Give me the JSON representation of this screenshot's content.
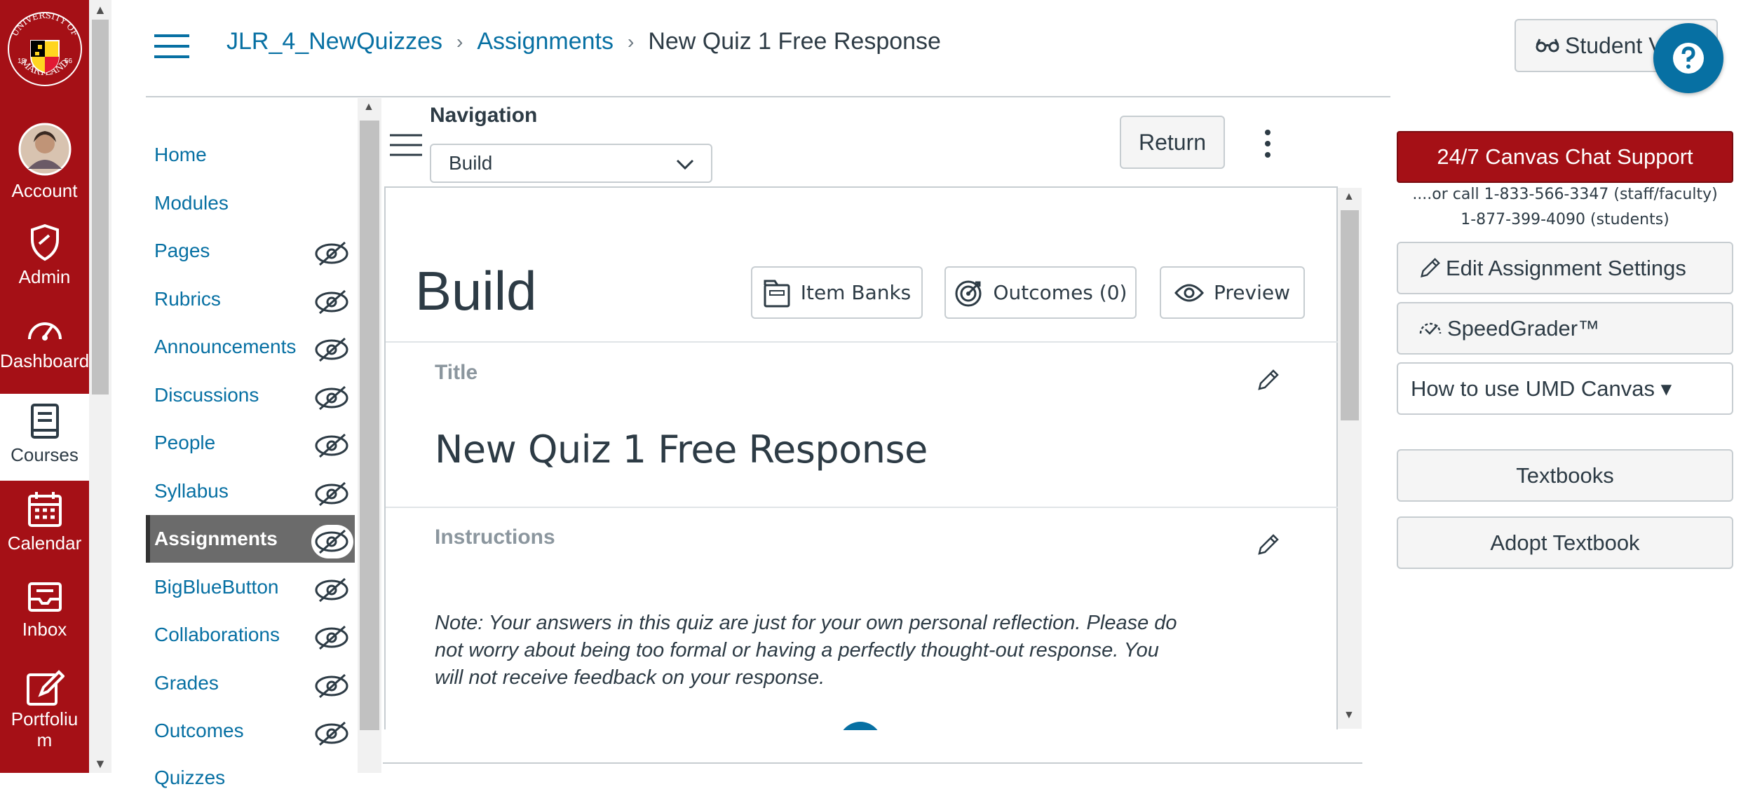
{
  "global_nav": {
    "logo_text": "UNIVERSITY OF MARYLAND 1856",
    "items": [
      {
        "label": "Account",
        "icon": "avatar"
      },
      {
        "label": "Admin",
        "icon": "admin-icon"
      },
      {
        "label": "Dashboard",
        "icon": "dashboard-icon"
      },
      {
        "label": "Courses",
        "icon": "courses-icon"
      },
      {
        "label": "Calendar",
        "icon": "calendar-icon"
      },
      {
        "label": "Inbox",
        "icon": "inbox-icon"
      },
      {
        "label": "Portfoliu m",
        "icon": "portfolium-icon"
      }
    ],
    "brand_color": "#a51016"
  },
  "header": {
    "breadcrumbs": [
      "JLR_4_NewQuizzes",
      "Assignments",
      "New Quiz 1 Free Response"
    ],
    "student_view_label": "Student View"
  },
  "course_nav": {
    "items": [
      {
        "label": "Home",
        "hidden": false
      },
      {
        "label": "Modules",
        "hidden": false
      },
      {
        "label": "Pages",
        "hidden": true
      },
      {
        "label": "Rubrics",
        "hidden": true
      },
      {
        "label": "Announcements",
        "hidden": true
      },
      {
        "label": "Discussions",
        "hidden": true
      },
      {
        "label": "People",
        "hidden": true
      },
      {
        "label": "Syllabus",
        "hidden": true
      },
      {
        "label": "Assignments",
        "hidden": true,
        "active": true
      },
      {
        "label": "BigBlueButton",
        "hidden": true
      },
      {
        "label": "Collaborations",
        "hidden": true
      },
      {
        "label": "Grades",
        "hidden": true
      },
      {
        "label": "Outcomes",
        "hidden": true
      },
      {
        "label": "Quizzes",
        "hidden": true
      }
    ]
  },
  "quiz": {
    "navigation_label": "Navigation",
    "navigation_select": "Build",
    "return_label": "Return",
    "page_title": "Build",
    "tools": {
      "item_banks": "Item Banks",
      "outcomes": "Outcomes (0)",
      "preview": "Preview"
    },
    "title_label": "Title",
    "title_value": "New Quiz 1 Free Response",
    "instructions_label": "Instructions",
    "instructions_text": "Note: Your answers in this quiz are just for your own personal reflection. Please do not worry about being too formal or having a perfectly thought-out response. You will not receive feedback on your response."
  },
  "right_panel": {
    "chat_support": "24/7 Canvas Chat Support",
    "call_staff": "....or call 1-833-566-3347 (staff/faculty)",
    "call_students": "1-877-399-4090 (students)",
    "edit_settings": "Edit Assignment Settings",
    "speedgrader": "SpeedGrader™",
    "how_to": "How to use UMD Canvas ▾",
    "textbooks": "Textbooks",
    "adopt_textbook": "Adopt Textbook",
    "help_icon": "question-icon"
  }
}
